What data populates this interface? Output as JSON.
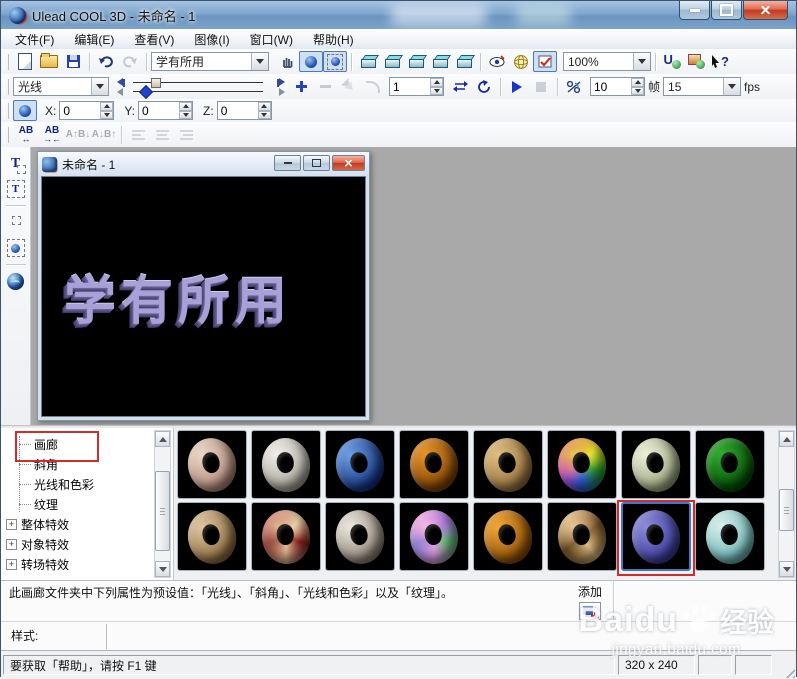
{
  "window": {
    "title": "Ulead COOL 3D - 未命名 - 1"
  },
  "menubar": {
    "items": [
      "文件(F)",
      "编辑(E)",
      "查看(V)",
      "图像(I)",
      "窗口(W)",
      "帮助(H)"
    ]
  },
  "toolbar_standard": {
    "text_style_combo": "学有所用",
    "zoom_combo": "100%"
  },
  "toolbar_animation": {
    "attribute_combo": "光线",
    "current_frame": "1",
    "total_frames": "10",
    "frames_label": "帧",
    "fps_value": "15",
    "fps_label": "fps"
  },
  "toolbar_position": {
    "x_label": "X:",
    "x_value": "0",
    "y_label": "Y:",
    "y_value": "0",
    "z_label": "Z:",
    "z_value": "0"
  },
  "toolbar_text": {
    "items": [
      {
        "glyph": "AB",
        "sub": "↔",
        "enabled": true
      },
      {
        "glyph": "AB",
        "sub": "→←",
        "enabled": true
      },
      {
        "glyph": "A↑B↓",
        "sub": "",
        "enabled": false
      },
      {
        "glyph": "A↓B↑",
        "sub": "",
        "enabled": false
      }
    ]
  },
  "icons": {
    "help_question": "?",
    "ulead_letter": "U",
    "text_tool_letter": "T"
  },
  "child_window": {
    "title": "未命名 - 1",
    "canvas_text": "学有所用"
  },
  "attribute_tree": {
    "items": [
      {
        "label": "画廊",
        "level": 1,
        "annotated": true
      },
      {
        "label": "斜角",
        "level": 1
      },
      {
        "label": "光线和色彩",
        "level": 1
      },
      {
        "label": "纹理",
        "level": 1
      },
      {
        "label": "整体特效",
        "level": 0,
        "expandable": true
      },
      {
        "label": "对象特效",
        "level": 0,
        "expandable": true
      },
      {
        "label": "转场特效",
        "level": 0,
        "expandable": true
      }
    ]
  },
  "gallery": {
    "rows": [
      [
        {
          "name": "pink-marble-ring",
          "hi": "#ecd8c8",
          "base": "#b08878"
        },
        {
          "name": "ivory-gold-ring",
          "hi": "#f2f0ea",
          "base": "#a8a49a"
        },
        {
          "name": "blue-crystal-ring",
          "hi": "#6aa2e8",
          "base": "#16307e"
        },
        {
          "name": "orange-wood-ring",
          "hi": "#eb9426",
          "base": "#7e4406"
        },
        {
          "name": "wicker-ring",
          "hi": "#e2be80",
          "base": "#96713c"
        },
        {
          "name": "rainbow-ring",
          "hi": "#f0f060",
          "conic": [
            "#d02828",
            "#e8d820",
            "#28a028",
            "#2858d0",
            "#c838b8",
            "#d02828"
          ]
        },
        {
          "name": "celadon-marble-ring",
          "hi": "#eef2d8",
          "base": "#9aa47e"
        },
        {
          "name": "green-foil-ring",
          "hi": "#2fae2f",
          "base": "#064e06"
        }
      ],
      [
        {
          "name": "tan-marble-ring",
          "hi": "#e0c8a0",
          "base": "#8e6c40"
        },
        {
          "name": "red-collage-ring",
          "hi": "#f0d8b0",
          "conic": [
            "#a82828",
            "#e8d0a8",
            "#902020",
            "#e0b890",
            "#781818",
            "#a82828"
          ]
        },
        {
          "name": "rust-metal-ring",
          "hi": "#efeae0",
          "base": "#8f8274"
        },
        {
          "name": "iridescent-ring",
          "hi": "#f8c8f0",
          "conic": [
            "#e078c8",
            "#9060d0",
            "#60b870",
            "#d898e0",
            "#7868c8",
            "#e078c8"
          ]
        },
        {
          "name": "amber-ring",
          "hi": "#f4a832",
          "base": "#8e4e08"
        },
        {
          "name": "mottled-brown-ring",
          "hi": "#ecd0a0",
          "conic": [
            "#c89858",
            "#704820",
            "#e0c080",
            "#583810",
            "#c89858"
          ]
        },
        {
          "name": "blue-velvet-ring",
          "hi": "#8c8cdc",
          "base": "#3c3c9c",
          "selected": true,
          "annotated": true
        },
        {
          "name": "aqua-ring",
          "hi": "#d8f2ee",
          "base": "#6cb4b4"
        }
      ]
    ]
  },
  "info_panel": {
    "description": "此画廊文件夹中下列属性为预设值：「光线」、「斜角」、「光线和色彩」以及「纹理」。",
    "add_label": "添加"
  },
  "style_panel": {
    "label": "样式:"
  },
  "statusbar": {
    "help_text": "要获取「帮助」，请按 F1 键",
    "canvas_size": "320 x 240"
  },
  "watermark": {
    "brand": "Baidu",
    "brand_suffix": "经验",
    "url": "jingyan.baidu.com"
  },
  "colors": {
    "selection_blue": "#3f78c8",
    "annotation_red": "#d22d2d",
    "titlebar_blue": "#7fa6cd",
    "close_button_red": "#c03a22",
    "canvas_text_color": "#a8a1d8"
  }
}
